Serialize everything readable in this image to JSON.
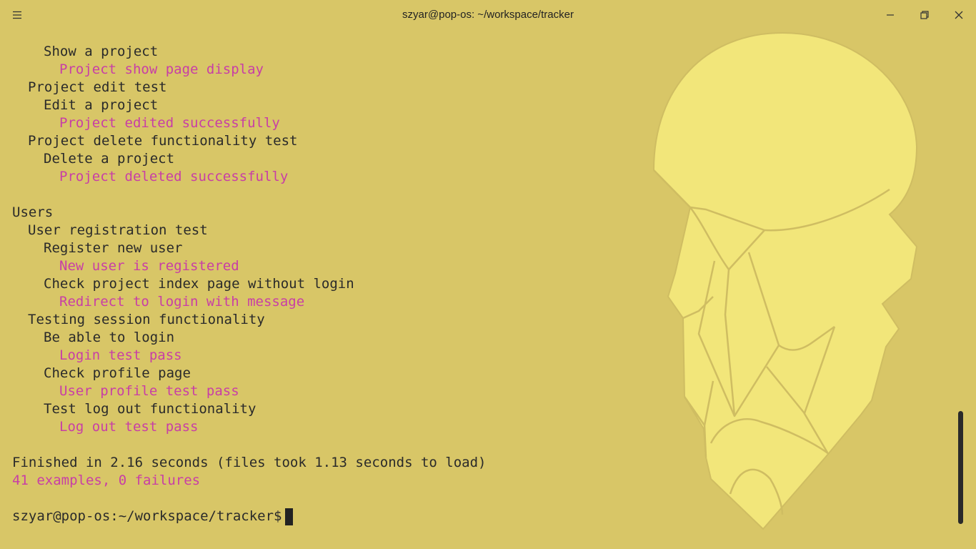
{
  "window": {
    "title": "szyar@pop-os: ~/workspace/tracker",
    "icons": {
      "menu": "hamburger-menu-icon",
      "minimize": "minimize-icon",
      "maximize": "restore-icon",
      "close": "close-icon"
    }
  },
  "terminal": {
    "lines": [
      {
        "text": "Show a project",
        "indent": 2,
        "kind": "text"
      },
      {
        "text": "Project show page display",
        "indent": 3,
        "kind": "pass"
      },
      {
        "text": "Project edit test",
        "indent": 1,
        "kind": "text"
      },
      {
        "text": "Edit a project",
        "indent": 2,
        "kind": "text"
      },
      {
        "text": "Project edited successfully",
        "indent": 3,
        "kind": "pass"
      },
      {
        "text": "Project delete functionality test",
        "indent": 1,
        "kind": "text"
      },
      {
        "text": "Delete a project",
        "indent": 2,
        "kind": "text"
      },
      {
        "text": "Project deleted successfully",
        "indent": 3,
        "kind": "pass"
      },
      {
        "text": "",
        "indent": 0,
        "kind": "blank"
      },
      {
        "text": "Users",
        "indent": 0,
        "kind": "text"
      },
      {
        "text": "User registration test",
        "indent": 1,
        "kind": "text"
      },
      {
        "text": "Register new user",
        "indent": 2,
        "kind": "text"
      },
      {
        "text": "New user is registered",
        "indent": 3,
        "kind": "pass"
      },
      {
        "text": "Check project index page without login",
        "indent": 2,
        "kind": "text"
      },
      {
        "text": "Redirect to login with message",
        "indent": 3,
        "kind": "pass"
      },
      {
        "text": "Testing session functionality",
        "indent": 1,
        "kind": "text"
      },
      {
        "text": "Be able to login",
        "indent": 2,
        "kind": "text"
      },
      {
        "text": "Login test pass",
        "indent": 3,
        "kind": "pass"
      },
      {
        "text": "Check profile page",
        "indent": 2,
        "kind": "text"
      },
      {
        "text": "User profile test pass",
        "indent": 3,
        "kind": "pass"
      },
      {
        "text": "Test log out functionality",
        "indent": 2,
        "kind": "text"
      },
      {
        "text": "Log out test pass",
        "indent": 3,
        "kind": "pass"
      },
      {
        "text": "",
        "indent": 0,
        "kind": "blank"
      },
      {
        "text": "Finished in 2.16 seconds (files took 1.13 seconds to load)",
        "indent": 0,
        "kind": "text"
      },
      {
        "text": "41 examples, 0 failures",
        "indent": 0,
        "kind": "pass"
      },
      {
        "text": "",
        "indent": 0,
        "kind": "blank"
      }
    ],
    "prompt": "szyar@pop-os:~/workspace/tracker$"
  },
  "colors": {
    "background": "#d8c667",
    "text": "#2a2a2a",
    "pass": "#c83ea6",
    "art": "#f2e67a",
    "art_stroke": "#cfbd62"
  }
}
